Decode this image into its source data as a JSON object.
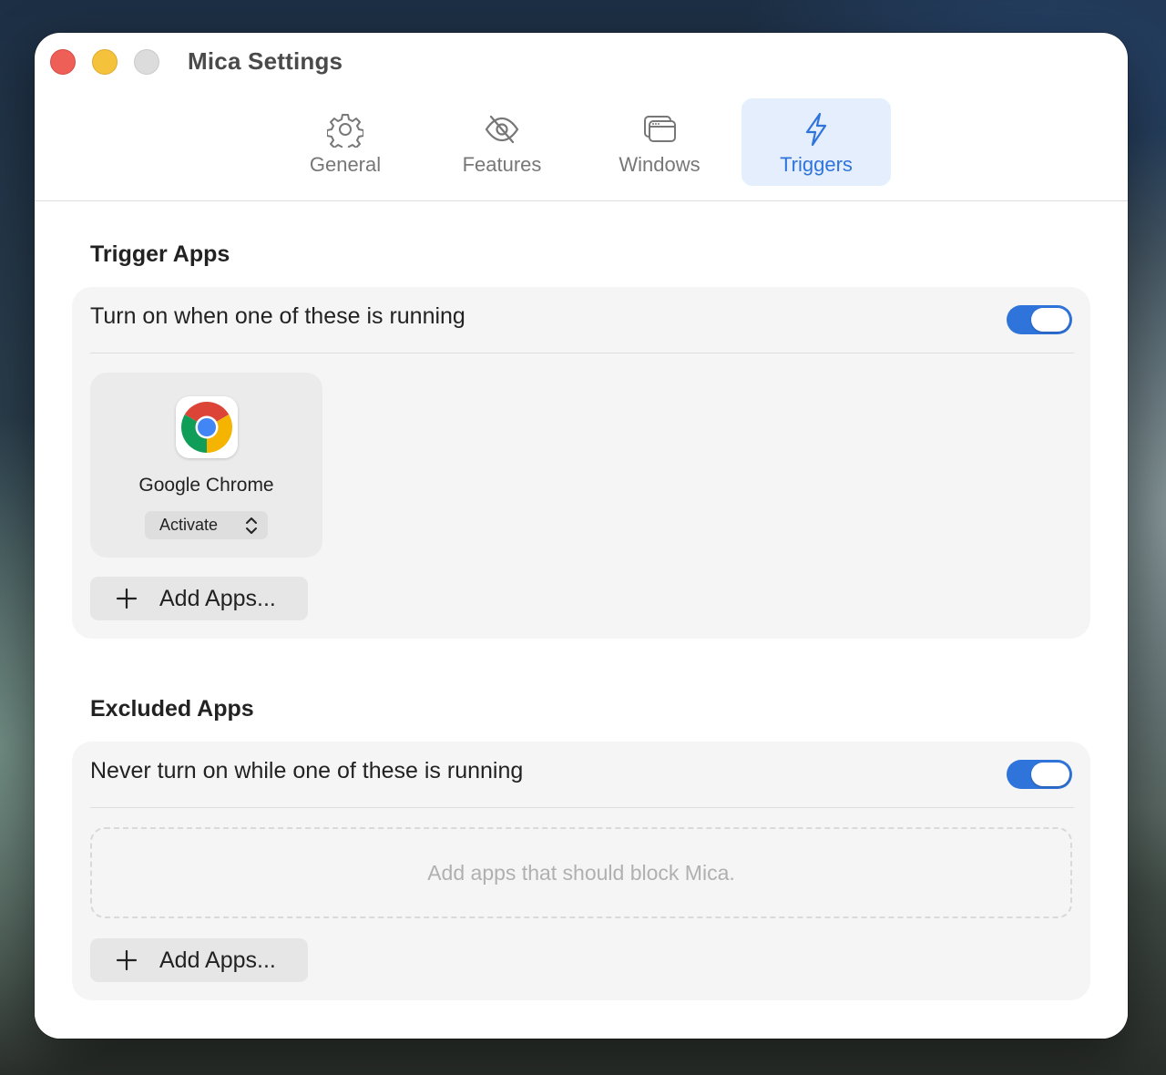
{
  "window": {
    "title": "Mica Settings"
  },
  "tabs": [
    {
      "label": "General",
      "icon": "gear-icon",
      "active": false
    },
    {
      "label": "Features",
      "icon": "eye-slash-icon",
      "active": false
    },
    {
      "label": "Windows",
      "icon": "windows-icon",
      "active": false
    },
    {
      "label": "Triggers",
      "icon": "bolt-icon",
      "active": true
    }
  ],
  "trigger_apps": {
    "title": "Trigger Apps",
    "toggle_label": "Turn on when one of these is running",
    "toggle_on": true,
    "apps": [
      {
        "name": "Google Chrome",
        "icon": "chrome-icon",
        "action": "Activate"
      }
    ],
    "add_label": "Add Apps..."
  },
  "excluded_apps": {
    "title": "Excluded Apps",
    "toggle_label": "Never turn on while one of these is running",
    "toggle_on": true,
    "empty_text": "Add apps that should block Mica.",
    "add_label": "Add Apps..."
  },
  "colors": {
    "accent": "#2f74db",
    "tab_active_bg": "#e4eefd",
    "card_bg": "#f5f5f5"
  }
}
